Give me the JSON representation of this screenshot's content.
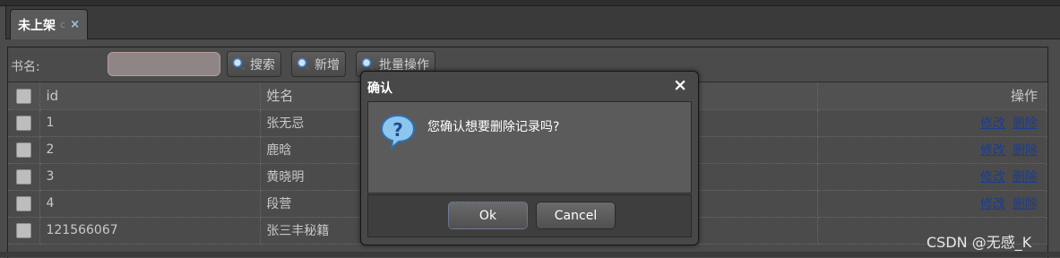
{
  "tab": {
    "title": "未上架",
    "refresh_glyph": "c",
    "close_glyph": "×"
  },
  "toolbar": {
    "field_label": "书名:",
    "search_value": "",
    "buttons": [
      {
        "label": "搜索",
        "icon": "magnifier-icon"
      },
      {
        "label": "新增",
        "icon": "magnifier-icon"
      },
      {
        "label": "批量操作",
        "icon": "magnifier-icon"
      }
    ]
  },
  "table": {
    "headers": [
      "id",
      "姓名",
      "",
      "操作"
    ],
    "rows": [
      {
        "id": "1",
        "name": "张无忌",
        "actions": [
          "修改",
          "删除"
        ]
      },
      {
        "id": "2",
        "name": "鹿晗",
        "actions": [
          "修改",
          "删除"
        ]
      },
      {
        "id": "3",
        "name": "黄晓明",
        "actions": [
          "修改",
          "删除"
        ]
      },
      {
        "id": "4",
        "name": "段营",
        "actions": [
          "修改",
          "删除"
        ]
      },
      {
        "id": "121566067",
        "name": "张三丰秘籍",
        "actions": []
      }
    ]
  },
  "dialog": {
    "title": "确认",
    "close_glyph": "×",
    "icon": "question-icon",
    "message": "您确认想要删除记录吗?",
    "ok_label": "Ok",
    "cancel_label": "Cancel"
  },
  "watermark": "CSDN @无感_K",
  "colors": {
    "background": "#4b4b4b",
    "link": "#1c3d8c",
    "dialog_text": "#ffffff"
  }
}
